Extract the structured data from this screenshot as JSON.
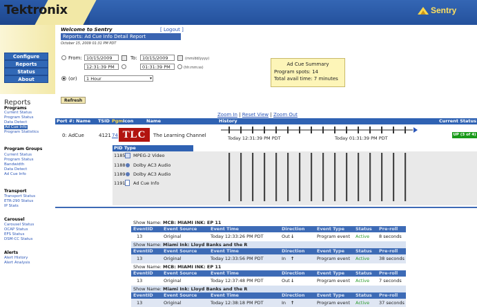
{
  "brand": {
    "logo": "Tektronix",
    "product": "Sentry"
  },
  "nav": {
    "buttons": [
      "Configure",
      "Reports",
      "Status",
      "About"
    ],
    "reports_title": "Reports",
    "sections": [
      {
        "heading": "Programs",
        "links": [
          "Current Status",
          "Program Status",
          "Data Detect",
          "Ad Cue Info",
          "Program Statistics"
        ]
      },
      {
        "heading": "Program Groups",
        "links": [
          "Current Status",
          "Program Status",
          "Bandwidth",
          "Data Detect",
          "Ad Cue Info"
        ]
      },
      {
        "heading": "Transport",
        "links": [
          "Transport Status",
          "ETR-290 Status",
          "IP Stats"
        ]
      },
      {
        "heading": "Carousel",
        "links": [
          "Carousel Status",
          "OCAP Status",
          "EFS Status",
          "DSM-CC Status"
        ]
      },
      {
        "heading": "Alerts",
        "links": [
          "Alert History",
          "Alert Analysis"
        ]
      }
    ]
  },
  "page": {
    "welcome": "Welcome to Sentry",
    "logout": "[ Logout ]",
    "title": "Reports: Ad Cue Info Detail Report",
    "datestamp": "October 15, 2009 01:31 PM PDT"
  },
  "form": {
    "from_label": "From:",
    "from_date": "10/15/2009",
    "to_label": "To:",
    "to_date": "10/15/2009",
    "date_hint": "(mm/dd/yyyy)",
    "from_time": "12:31:39 PM",
    "to_time": "01:31:39 PM",
    "time_hint": "(hh:mm:ss)",
    "or_label": "(or)",
    "range_value": "1 Hour",
    "refresh": "Refresh"
  },
  "summary": {
    "title": "Ad Cue Summary",
    "spots": "Program spots:  14",
    "avail": "Total avail time: 7 minutes"
  },
  "zoom": {
    "in": "Zoom In",
    "sep1": "|",
    "reset": "Reset View",
    "sep2": "|",
    "out": "Zoom Out"
  },
  "table": {
    "headers": {
      "port": "Port #: Name",
      "tsid": "TSID",
      "pgm": "Pgm",
      "icon": "Icon",
      "name": "Name",
      "history": "History",
      "status": "Current Status"
    },
    "row": {
      "port": "0: AdCue",
      "tsid": "4121",
      "pgm": "74",
      "logo": "TLC",
      "name": "The Learning Channel",
      "time_start": "Today 12:31:39 PM PDT",
      "time_end": "Today 01:31:39 PM PDT",
      "status": "UP (3 of 4)"
    }
  },
  "pids": {
    "header": "PID Type",
    "rows": [
      {
        "pid": "1185",
        "type": "MPEG-2 Video"
      },
      {
        "pid": "1188",
        "type": "Dolby AC3 Audio"
      },
      {
        "pid": "1189",
        "type": "Dolby AC3 Audio"
      },
      {
        "pid": "1191",
        "type": "Ad Cue Info"
      }
    ]
  },
  "events": {
    "show_prefix": "Show Name: ",
    "headers": [
      "EventID",
      "Event Source",
      "Event Time",
      "Direction",
      "Event Type",
      "Status",
      "Pre-roll"
    ],
    "items": [
      {
        "show": "MCB: MIAMI INK: EP 11",
        "id": "13",
        "source": "Original",
        "time": "Today 12:33:26 PM PDT",
        "dir": "Out",
        "arrow": "↓",
        "type": "Program event",
        "status": "Active",
        "preroll": "8 seconds"
      },
      {
        "show": "Miami Ink: Lloyd Banks and the R",
        "id": "13",
        "source": "Original",
        "time": "Today 12:33:56 PM PDT",
        "dir": "In",
        "arrow": "↑",
        "type": "Program event",
        "status": "Active",
        "preroll": "38 seconds"
      },
      {
        "show": "MCB: MIAMI INK: EP 11",
        "id": "13",
        "source": "Original",
        "time": "Today 12:37:48 PM PDT",
        "dir": "Out",
        "arrow": "↓",
        "type": "Program event",
        "status": "Active",
        "preroll": "7 seconds"
      },
      {
        "show": "Miami Ink: Lloyd Banks and the R",
        "id": "13",
        "source": "Original",
        "time": "Today 12:38:18 PM PDT",
        "dir": "In",
        "arrow": "↑",
        "type": "Program event",
        "status": "Active",
        "preroll": "37 seconds"
      }
    ]
  },
  "colors": {
    "header_blue": "#2a5aa8",
    "table_blue": "#2f62b3",
    "status_green": "#1a9a1a",
    "tlc_red": "#b2140f"
  }
}
